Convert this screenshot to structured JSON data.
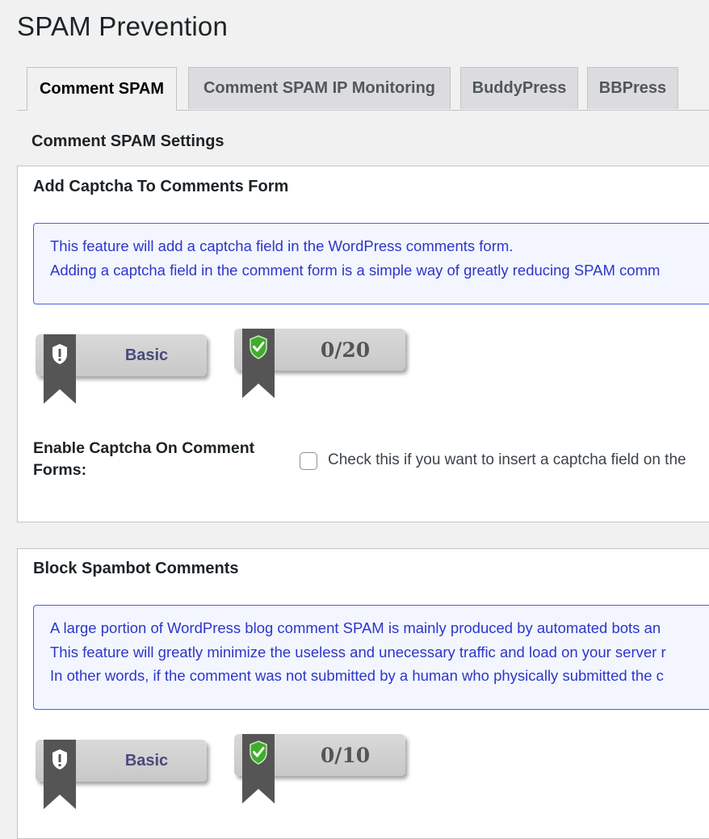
{
  "page": {
    "title": "SPAM Prevention"
  },
  "tabs": [
    {
      "label": "Comment SPAM",
      "active": true
    },
    {
      "label": "Comment SPAM IP Monitoring",
      "active": false
    },
    {
      "label": "BuddyPress",
      "active": false
    },
    {
      "label": "BBPress",
      "active": false
    }
  ],
  "section": {
    "heading": "Comment SPAM Settings"
  },
  "captcha_box": {
    "title": "Add Captcha To Comments Form",
    "info_lines": [
      "This feature will add a captcha field in the WordPress comments form.",
      "Adding a captcha field in the comment form is a simple way of greatly reducing SPAM comm"
    ],
    "level_badge": {
      "label": "Basic",
      "icon": "shield-warning-icon"
    },
    "score_badge": {
      "label": "0/20",
      "icon": "shield-check-icon"
    },
    "setting_label": "Enable Captcha On Comment Forms:",
    "checkbox_desc": "Check this if you want to insert a captcha field on the"
  },
  "spambot_box": {
    "title": "Block Spambot Comments",
    "info_lines": [
      "A large portion of WordPress blog comment SPAM is mainly produced by automated bots an",
      "This feature will greatly minimize the useless and unecessary traffic and load on your server r",
      "In other words, if the comment was not submitted by a human who physically submitted the c"
    ],
    "level_badge": {
      "label": "Basic",
      "icon": "shield-warning-icon"
    },
    "score_badge": {
      "label": "0/10",
      "icon": "shield-check-icon"
    }
  },
  "colors": {
    "info_border": "#4a5ee6",
    "info_text": "#2d36c9",
    "ribbon": "#555555",
    "check_shield": "#3fae2a"
  }
}
